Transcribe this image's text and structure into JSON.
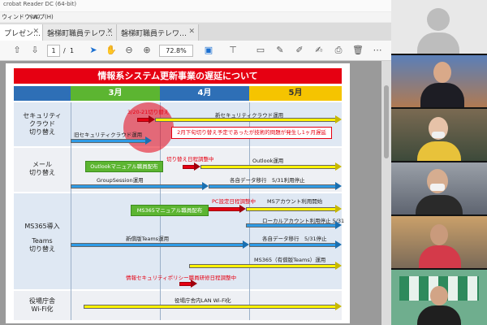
{
  "window": {
    "title_fragment": "crobat Reader DC (64-bit)",
    "menu": [
      "ウィンドウ(W)",
      "ヘルプ(H)"
    ]
  },
  "tabs": [
    {
      "label": "プレゼン…",
      "active": true
    },
    {
      "label": "磐梯町職員テレワ…",
      "active": false
    },
    {
      "label": "磐梯町職員テレワ…",
      "active": false
    }
  ],
  "toolbar": {
    "page_current": "1",
    "page_separator": "/",
    "page_total": "1",
    "zoom": "72.8%",
    "icons": [
      "page-up-icon",
      "page-down-icon",
      "pointer-icon",
      "hand-icon",
      "zoom-out-icon",
      "zoom-in-icon",
      "fit-page-icon",
      "scroll-mode-icon",
      "comment-icon",
      "highlight-icon",
      "draw-icon",
      "sign-icon",
      "fill-sign-icon",
      "delete-icon",
      "more-icon"
    ]
  },
  "slide": {
    "title": "情報系システム更新事業の遅延について",
    "months": [
      "3月",
      "4月",
      "5月"
    ],
    "month_colors": [
      "#5cb531",
      "#2e6fb6",
      "#f5c400"
    ],
    "rows": [
      {
        "label_lines": [
          "セキュリティ",
          "クラウド",
          "切り替え"
        ]
      },
      {
        "label_lines": [
          "メール",
          "切り替え"
        ]
      },
      {
        "label_lines": [
          "MS365導入",
          "",
          "Teams",
          "切り替え"
        ]
      },
      {
        "label_lines": [
          "役場庁舎",
          "Wi-Fi化"
        ]
      }
    ],
    "items": {
      "switch_date": "3/20-21切り替え",
      "new_security_cloud": "新セキュリティクラウド運用",
      "old_security_cloud": "旧セキュリティクラウド運用",
      "delay_note": "2月下旬切り替え予定であったが技術的問題が発生し1ヶ月遅延",
      "outlook_manual": "Outlookマニュアル職員配布",
      "switch_schedule": "切り替え日程調整中",
      "outlook_ops": "Outlook運用",
      "groupsession_ops": "GroupSession運用",
      "data_migration_mail": "各自データ移行　5/31利用停止",
      "pc_setup": "PC設定日程調整中",
      "ms_account_start": "MSアカウント利用開始",
      "ms365_manual": "MS365マニュアル職員配布",
      "local_account_stop": "ローカルアカウント利用停止 5/31",
      "new_teams_ops": "新償版Teams運用",
      "data_migration_teams": "各自データ移行　5/31停止",
      "paid_teams_ops": "MS365（有償版Teams）運用",
      "policy_training": "情報セキュリティポリシー職員研修日程調整中",
      "wifi_ops": "役場庁舎内LAN Wi-Fi化"
    }
  },
  "participants": [
    {
      "name": "camera-off-participant"
    },
    {
      "name": "participant-2"
    },
    {
      "name": "participant-3"
    },
    {
      "name": "participant-4"
    },
    {
      "name": "participant-5"
    },
    {
      "name": "participant-6"
    }
  ]
}
